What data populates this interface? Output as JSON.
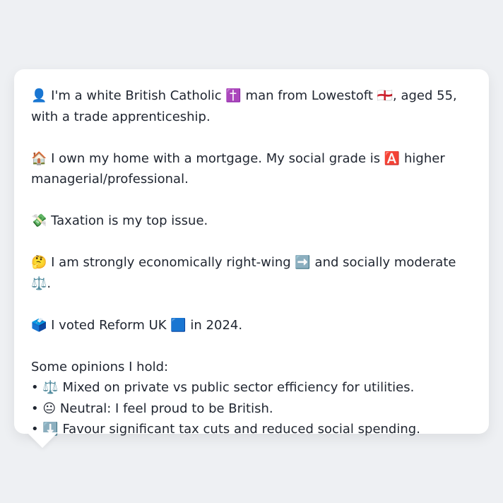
{
  "profile": {
    "line1": "👤 I'm a white British Catholic ✝️ man from Lowestoft 🏴󠁧󠁢󠁥󠁮󠁧󠁿, aged 55, with a trade apprenticeship.",
    "line2": "🏠 I own my home with a mortgage. My social grade is 🅰️ higher managerial/professional.",
    "line3": "💸 Taxation is my top issue.",
    "line4": "🤔 I am strongly economically right-wing ➡️ and socially moderate ⚖️.",
    "line5": "🗳️ I voted Reform UK 🟦 in 2024."
  },
  "opinions": {
    "heading": "Some opinions I hold:",
    "items": [
      "• ⚖️ Mixed on private vs public sector efficiency for utilities.",
      "• 😐 Neutral: I feel proud to be British.",
      "• ⬇️ Favour significant tax cuts and reduced social spending."
    ]
  },
  "colors": {
    "background": "#eef0f3",
    "bubble": "#ffffff",
    "text": "#1f2530"
  }
}
